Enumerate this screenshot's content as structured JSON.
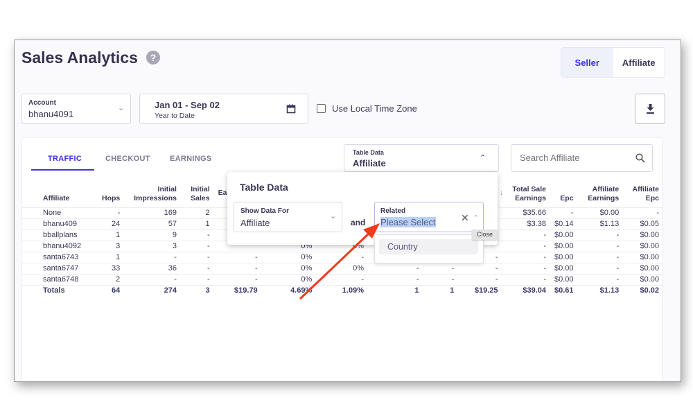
{
  "header": {
    "title": "Sales Analytics",
    "help_icon": "?",
    "toggle": [
      "Seller",
      "Affiliate"
    ],
    "active_toggle": "Seller"
  },
  "filters": {
    "account_label": "Account",
    "account_value": "bhanu4091",
    "date_range": "Jan 01 - Sep 02",
    "date_preset": "Year to Date",
    "local_tz_label": "Use Local Time Zone",
    "local_tz_checked": false
  },
  "tabs": [
    "TRAFFIC",
    "CHECKOUT",
    "EARNINGS"
  ],
  "table_data_select": {
    "label": "Table Data",
    "value": "Affiliate"
  },
  "search": {
    "placeholder": "Search Affiliate"
  },
  "table": {
    "headers": [
      [
        "Affiliate"
      ],
      [
        "Hops"
      ],
      [
        "Initial",
        "Impressions"
      ],
      [
        "Initial",
        "Sales"
      ],
      [
        "Ea"
      ],
      [
        ""
      ],
      [
        ""
      ],
      [
        ""
      ],
      [
        ""
      ],
      [
        ""
      ],
      [
        "Total Sale",
        "Earnings"
      ],
      [
        "Epc"
      ],
      [
        "Affiliate",
        "Earnings"
      ],
      [
        "Affiliate",
        "Epc"
      ]
    ],
    "rows": [
      [
        "None",
        "-",
        "169",
        "2",
        "",
        "",
        "",
        "",
        "",
        "",
        "$35.66",
        "-",
        "$0.00",
        "-"
      ],
      [
        "bhanu409",
        "24",
        "57",
        "1",
        "",
        "",
        "",
        "",
        "",
        "",
        "$3.38",
        "$0.14",
        "$1.13",
        "$0.05"
      ],
      [
        "bballplans",
        "1",
        "9",
        "-",
        "",
        "",
        "",
        "",
        "",
        "",
        "-",
        "$0.00",
        "-",
        "$0.00"
      ],
      [
        "bhanu4092",
        "3",
        "3",
        "-",
        "",
        "0%",
        "0%",
        "",
        "",
        "",
        "-",
        "$0.00",
        "-",
        "$0.00"
      ],
      [
        "santa6743",
        "1",
        "-",
        "-",
        "-",
        "0%",
        "-",
        "-",
        "-",
        "-",
        "-",
        "$0.00",
        "-",
        "$0.00"
      ],
      [
        "santa6747",
        "33",
        "36",
        "-",
        "-",
        "0%",
        "0%",
        "-",
        "-",
        "-",
        "-",
        "$0.00",
        "-",
        "$0.00"
      ],
      [
        "santa6748",
        "2",
        "-",
        "-",
        "-",
        "0%",
        "-",
        "-",
        "-",
        "-",
        "-",
        "$0.00",
        "-",
        "$0.00"
      ]
    ],
    "totals": [
      "Totals",
      "64",
      "274",
      "3",
      "$19.79",
      "4.69%",
      "1.09%",
      "1",
      "1",
      "$19.25",
      "$39.04",
      "$0.61",
      "$1.13",
      "$0.02"
    ]
  },
  "popup": {
    "title": "Table Data",
    "show_for_label": "Show Data For",
    "show_for_value": "Affiliate",
    "joiner": "and",
    "related_label": "Related",
    "related_value": "Please Select",
    "options": [
      "Country"
    ],
    "tooltip": "Close"
  },
  "colors": {
    "accent": "#3d2fe0",
    "arrow": "#f03a1a"
  }
}
